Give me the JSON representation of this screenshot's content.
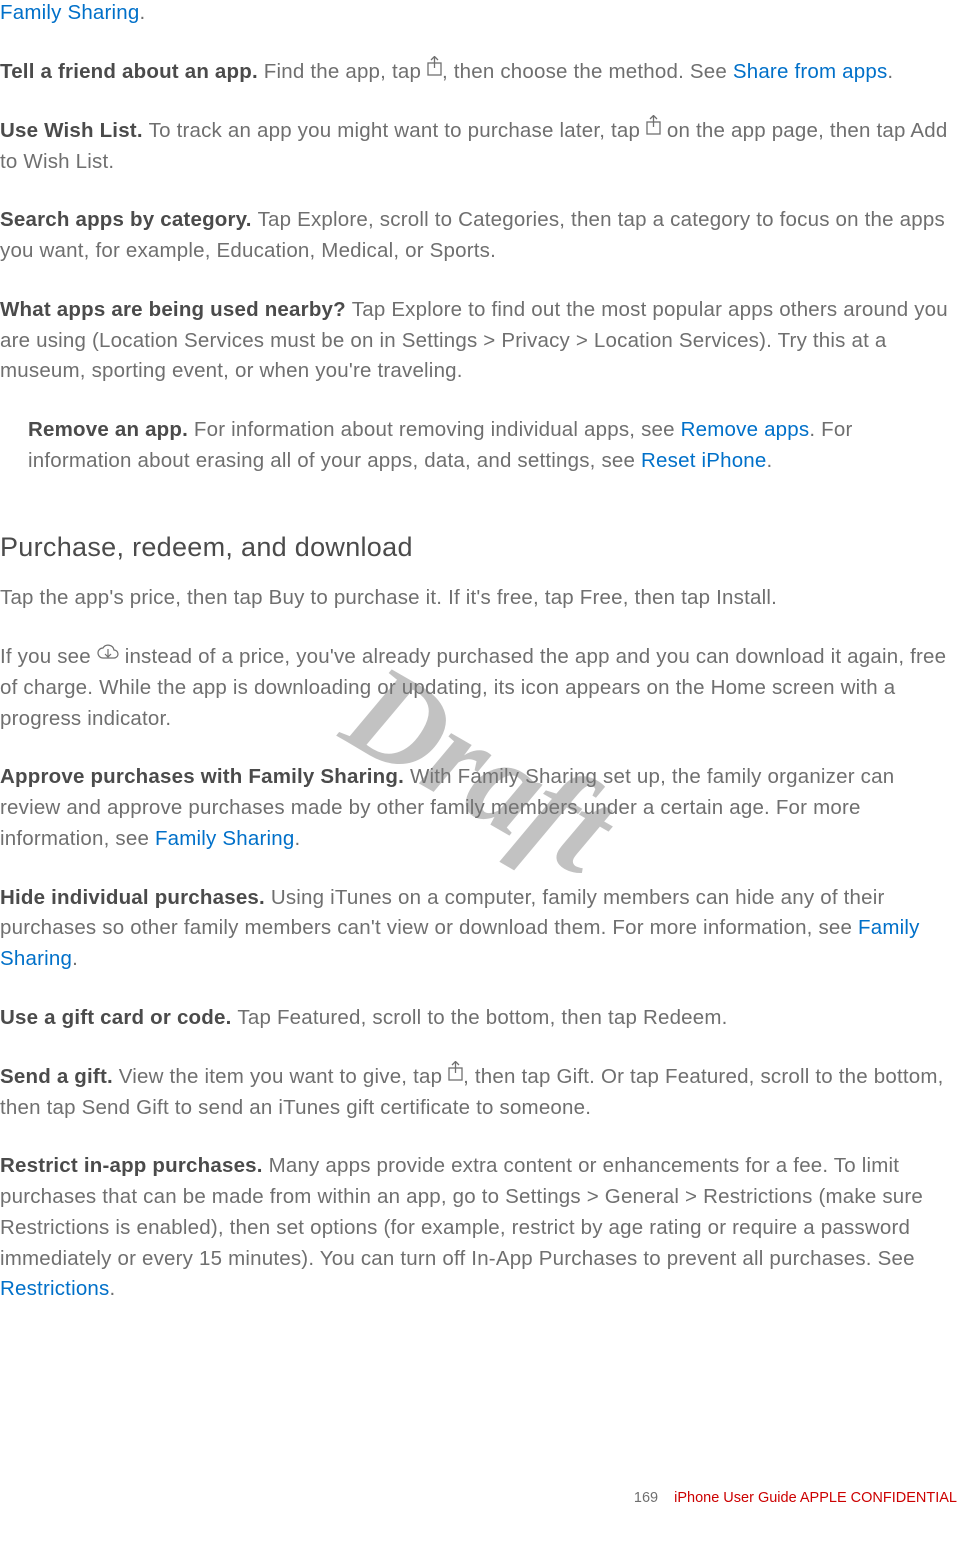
{
  "watermark": "Draft",
  "links": {
    "family_sharing_top": "Family Sharing",
    "share_from_apps": "Share from apps",
    "remove_apps": "Remove apps",
    "reset_iphone": "Reset iPhone",
    "family_sharing_mid": "Family Sharing",
    "family_sharing_hide": "Family Sharing",
    "restrictions": "Restrictions"
  },
  "para1_suffix": ".",
  "para2": {
    "bold": "Tell a friend about an app. ",
    "text_a": "Find the app, tap ",
    "text_b": ", then choose the method. See "
  },
  "para2_suffix": ".",
  "para3": {
    "bold": "Use Wish List. ",
    "text": "To track an app you might want to purchase later, tap ",
    "text_b": " on the app page, then tap Add to Wish List."
  },
  "para4": {
    "bold": "Search apps by category. ",
    "text": "Tap Explore, scroll to Categories, then tap a category to focus on the apps you want, for example, Education, Medical, or Sports."
  },
  "para5": {
    "bold": "What apps are being used nearby? ",
    "text": "Tap Explore to find out the most popular apps others around you are using (Location Services must be on in Settings > Privacy > Location Services). Try this at a museum, sporting event, or when you're traveling."
  },
  "para6": {
    "bold": "Remove an app.  ",
    "text_a": "For information about removing individual apps, see ",
    "text_b": ". For information about erasing all of your apps, data, and settings, see ",
    "text_c": "."
  },
  "heading": "Purchase, redeem, and download",
  "para7": "Tap the app's price, then tap Buy to purchase it. If it's free, tap Free, then tap Install.",
  "para8_a": "If you see ",
  "para8_b": " instead of a price, you've already purchased the app and you can download it again, free of charge. While the app is downloading or updating, its icon appears on the Home screen with a progress indicator.",
  "para9": {
    "bold": "Approve purchases with Family Sharing. ",
    "text_a": "With Family Sharing set up, the family organizer can review and approve purchases made by other family members under a certain age. For more information, see ",
    "text_b": "."
  },
  "para10": {
    "bold": "Hide individual purchases. ",
    "text_a": "Using iTunes on a computer, family members can hide any of their purchases so other family members can't view or download them. For more information, see ",
    "text_b": "."
  },
  "para11": {
    "bold": "Use a gift card or code. ",
    "text": "Tap Featured, scroll to the bottom, then tap Redeem."
  },
  "para12": {
    "bold": "Send a gift. ",
    "text_a": "View the item you want to give, tap ",
    "text_b": ", then tap Gift. Or tap Featured, scroll to the bottom, then tap Send Gift to send an iTunes gift certificate to someone."
  },
  "para13": {
    "bold": "Restrict in-app purchases. ",
    "text_a": "Many apps provide extra content or enhancements for a fee. To limit purchases that can be made from within an app, go to Settings > General > Restrictions (make sure Restrictions is enabled), then set options (for example, restrict by age rating or require a password immediately or every 15 minutes). You can turn off In-App Purchases to prevent all purchases. See ",
    "text_b": "."
  },
  "footer": {
    "page": "169",
    "title": "iPhone User Guide",
    "confidential": "  APPLE CONFIDENTIAL"
  }
}
